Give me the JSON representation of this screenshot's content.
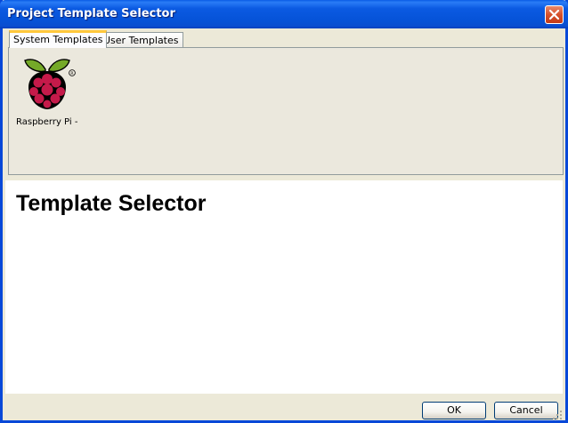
{
  "window": {
    "title": "Project Template Selector"
  },
  "tabs": [
    {
      "label": "System Templates",
      "active": true
    },
    {
      "label": "User Templates",
      "active": false
    }
  ],
  "templates": [
    {
      "label": "Raspberry Pi -",
      "icon": "raspberry-pi-logo"
    }
  ],
  "content": {
    "heading": "Template Selector"
  },
  "buttons": {
    "ok": "OK",
    "cancel": "Cancel"
  },
  "colors": {
    "titlebar": "#0653d8",
    "active_tab_accent": "#ffc83c",
    "close_button": "#d6512b"
  }
}
